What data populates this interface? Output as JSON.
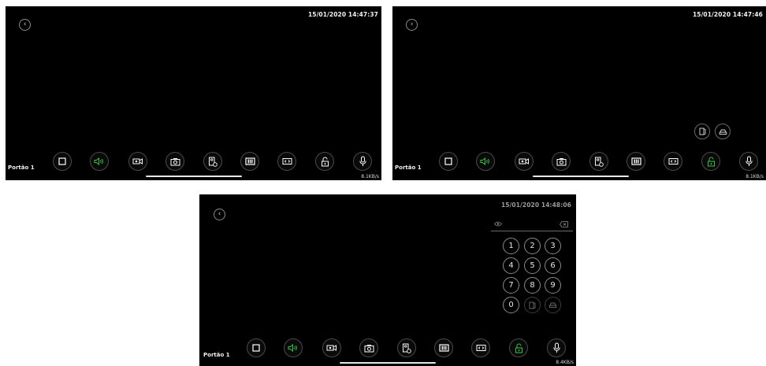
{
  "screens": [
    {
      "timestamp": "15/01/2020 14:47:37",
      "camera_label": "Portão 1",
      "speed": "8.1KB/s"
    },
    {
      "timestamp": "15/01/2020 14:47:46",
      "camera_label": "Portão 1",
      "speed": "8.1KB/s"
    },
    {
      "timestamp": "15/01/2020 14:48:06",
      "camera_label": "Portão 1",
      "speed": "8.4KB/s"
    }
  ],
  "back_glyph": "‹",
  "keypad": {
    "keys": [
      "1",
      "2",
      "3",
      "4",
      "5",
      "6",
      "7",
      "8",
      "9",
      "0"
    ]
  },
  "icons": {
    "toolbar": [
      "stop-icon",
      "speaker-icon",
      "record-icon",
      "snapshot-icon",
      "playback-icon",
      "stream-icon",
      "aspect-icon",
      "unlock-icon",
      "microphone-icon"
    ],
    "extra": [
      "door-icon",
      "gate-icon"
    ]
  },
  "colors": {
    "background": "#000000",
    "accent_green": "#3fc04a",
    "text": "#ffffff"
  }
}
